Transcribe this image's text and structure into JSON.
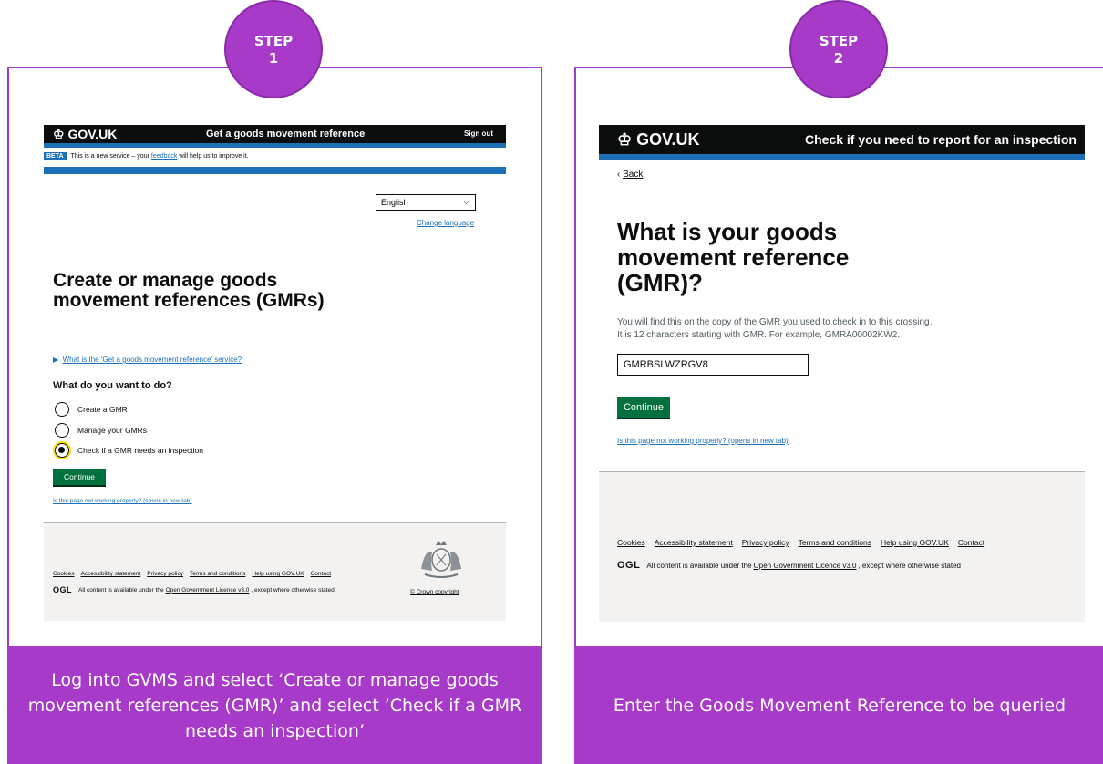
{
  "step1": {
    "badge_word": "STEP",
    "badge_num": "1",
    "caption": "Log into GVMS and select ‘Create or manage goods movement references (GMR)’ and select ’Check if a GMR needs an inspection’",
    "screen": {
      "logo": "GOV.UK",
      "service_name": "Get a goods movement reference",
      "sign_out": "Sign out",
      "beta_tag": "BETA",
      "beta_pre": "This is a new service – your",
      "beta_link": "feedback",
      "beta_post": "will help us to improve it.",
      "language": "English",
      "change_language": "Change language",
      "title": "Create or manage goods movement references (GMRs)",
      "details_summary": "What is the 'Get a goods movement reference' service?",
      "question": "What do you want to do?",
      "options": [
        "Create a GMR",
        "Manage your GMRs",
        "Check if a GMR needs an inspection"
      ],
      "selected_option": 2,
      "continue": "Continue",
      "not_working": "Is this page not working properly? (opens in new tab)",
      "footer_links": [
        "Cookies",
        "Accessibility statement",
        "Privacy policy",
        "Terms and conditions",
        "Help using GOV.UK",
        "Contact"
      ],
      "ogl": "OGL",
      "licence_pre": "All content is available under the",
      "licence_link": "Open Government Licence v3.0",
      "licence_post": ", except where otherwise stated",
      "crown_copyright": "© Crown copyright"
    }
  },
  "step2": {
    "badge_word": "STEP",
    "badge_num": "2",
    "caption": "Enter the Goods Movement Reference to be queried",
    "screen": {
      "logo": "GOV.UK",
      "service_name": "Check if you need to report for an inspection",
      "back": "Back",
      "title": "What is your goods movement reference (GMR)?",
      "hint_line1": "You will find this on the copy of the GMR you used to check in to this crossing.",
      "hint_line2": "It is 12 characters starting with GMR. For example, GMRA00002KW2.",
      "gmr_value": "GMRBSLWZRGV8",
      "continue": "Continue",
      "not_working": "Is this page not working properly? (opens in new tab)",
      "footer_links": [
        "Cookies",
        "Accessibility statement",
        "Privacy policy",
        "Terms and conditions",
        "Help using GOV.UK",
        "Contact"
      ],
      "ogl": "OGL",
      "licence_pre": "All content is available under the",
      "licence_link": "Open Government Licence v3.0",
      "licence_post": ", except where otherwise stated"
    }
  },
  "colors": {
    "accent_purple": "#a83ac9",
    "govuk_blue": "#1d70b8",
    "govuk_green": "#00703c",
    "govuk_black": "#0b0c0c"
  }
}
